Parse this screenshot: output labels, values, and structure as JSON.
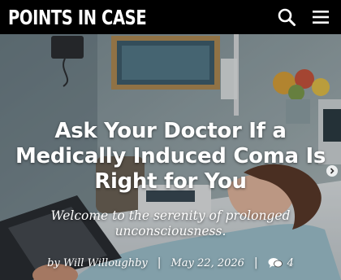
{
  "site": {
    "logo_text": "Points in Case"
  },
  "header": {
    "search_icon": "search-icon",
    "menu_icon": "hamburger-menu-icon"
  },
  "article": {
    "title": "Ask Your Doctor If a Medically Induced Coma Is Right for You",
    "subtitle": "Welcome to the serenity of prolonged unconsciousness.",
    "byline": "by Will Willoughby",
    "date": "May 22, 2026",
    "comment_count": "4",
    "separator": "|"
  },
  "colors": {
    "header_bg": "#000000",
    "text": "#ffffff"
  }
}
